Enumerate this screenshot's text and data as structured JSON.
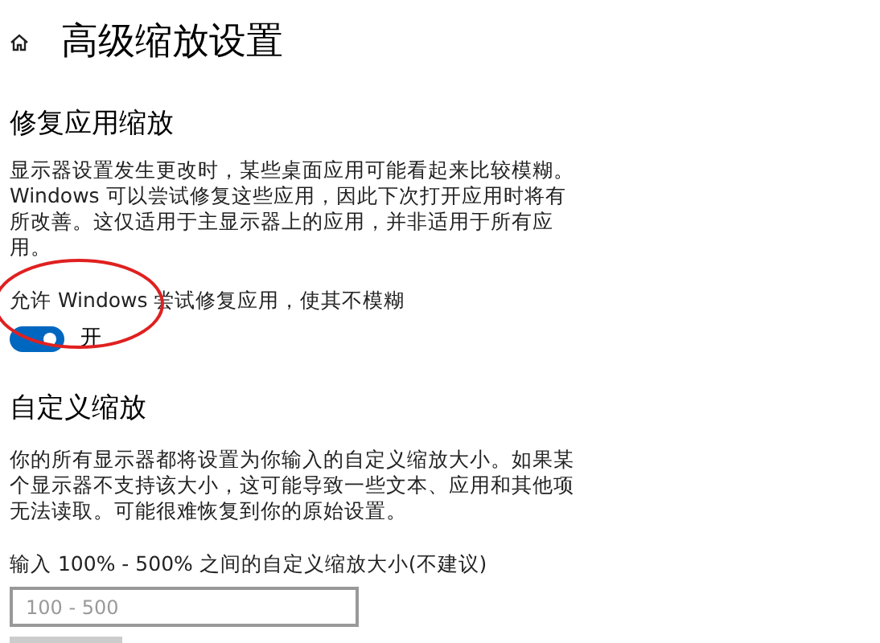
{
  "page": {
    "title": "高级缩放设置"
  },
  "fix_section": {
    "heading": "修复应用缩放",
    "description": "显示器设置发生更改时，某些桌面应用可能看起来比较模糊。Windows 可以尝试修复这些应用，因此下次打开应用时将有所改善。这仅适用于主显示器上的应用，并非适用于所有应用。",
    "toggle": {
      "label": "允许 Windows 尝试修复应用，使其不模糊",
      "on": true,
      "state_text": "开"
    }
  },
  "custom_section": {
    "heading": "自定义缩放",
    "description": "你的所有显示器都将设置为你输入的自定义缩放大小。如果某个显示器不支持该大小，这可能导致一些文本、应用和其他项无法读取。可能很难恢复到你的原始设置。",
    "field": {
      "label": "输入 100% - 500% 之间的自定义缩放大小(不建议)",
      "placeholder": "100 - 500"
    }
  }
}
